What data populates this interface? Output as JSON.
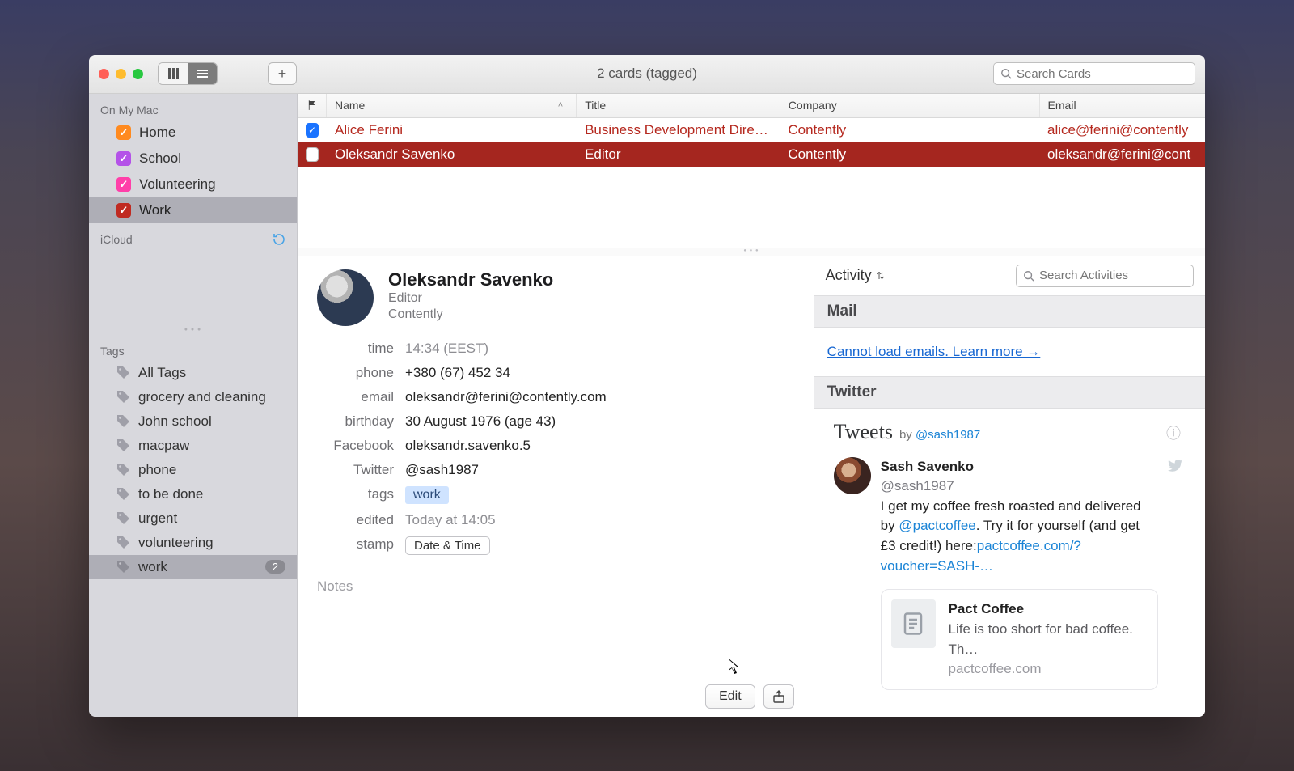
{
  "window": {
    "title": "2 cards (tagged)",
    "search_placeholder": "Search Cards"
  },
  "sidebar": {
    "section1_heading": "On My Mac",
    "lists": [
      {
        "label": "Home",
        "color": "#ff8a1f"
      },
      {
        "label": "School",
        "color": "#b452e8"
      },
      {
        "label": "Volunteering",
        "color": "#ff3fa9"
      },
      {
        "label": "Work",
        "color": "#c02a21"
      }
    ],
    "section2_heading": "iCloud",
    "tag_heading": "Tags",
    "tags": [
      {
        "label": "All Tags"
      },
      {
        "label": "grocery and cleaning"
      },
      {
        "label": "John school"
      },
      {
        "label": "macpaw"
      },
      {
        "label": "phone"
      },
      {
        "label": "to be done"
      },
      {
        "label": "urgent"
      },
      {
        "label": "volunteering"
      },
      {
        "label": "work",
        "count": "2",
        "selected": true
      }
    ]
  },
  "columns": {
    "flag": "",
    "name": "Name",
    "title": "Title",
    "company": "Company",
    "email": "Email"
  },
  "rows": [
    {
      "name": "Alice Ferini",
      "title": "Business Development Dire…",
      "company": "Contently",
      "email": "alice@ferini@contently",
      "checked": true,
      "selected": false
    },
    {
      "name": "Oleksandr Savenko",
      "title": "Editor",
      "company": "Contently",
      "email": "oleksandr@ferini@cont",
      "checked": false,
      "selected": true
    }
  ],
  "card": {
    "name": "Oleksandr Savenko",
    "job": "Editor",
    "company": "Contently",
    "labels": {
      "time": "time",
      "phone": "phone",
      "email": "email",
      "birthday": "birthday",
      "facebook": "Facebook",
      "twitter": "Twitter",
      "tags": "tags",
      "edited": "edited",
      "stamp": "stamp"
    },
    "values": {
      "time": "14:34 (EEST)",
      "phone": "+380 (67) 452 34",
      "email": "oleksandr@ferini@contently.com",
      "birthday": "30 August 1976 (age 43)",
      "facebook": "oleksandr.savenko.5",
      "twitter": "@sash1987",
      "tag": "work",
      "edited": "Today at 14:05",
      "stamp_button": "Date & Time"
    },
    "notes_placeholder": "Notes",
    "edit_label": "Edit"
  },
  "activity": {
    "dropdown": "Activity",
    "search_placeholder": "Search Activities",
    "mail_heading": "Mail",
    "mail_error": "Cannot load emails. Learn more →",
    "twitter_heading": "Twitter",
    "tweets_title": "Tweets",
    "tweets_by_prefix": "by",
    "tweets_by_handle": "@sash1987",
    "tweet": {
      "name": "Sash Savenko",
      "handle": "@sash1987",
      "part1": "I get my coffee fresh roasted and delivered by ",
      "mention": "@pactcoffee",
      "part2": ". Try it for yourself (and get £3 credit!) here:",
      "link": "pactcoffee.com/?voucher=SASH-…"
    },
    "linkcard": {
      "title": "Pact Coffee",
      "subtitle": "Life is too short for bad coffee. Th…",
      "domain": "pactcoffee.com"
    }
  }
}
